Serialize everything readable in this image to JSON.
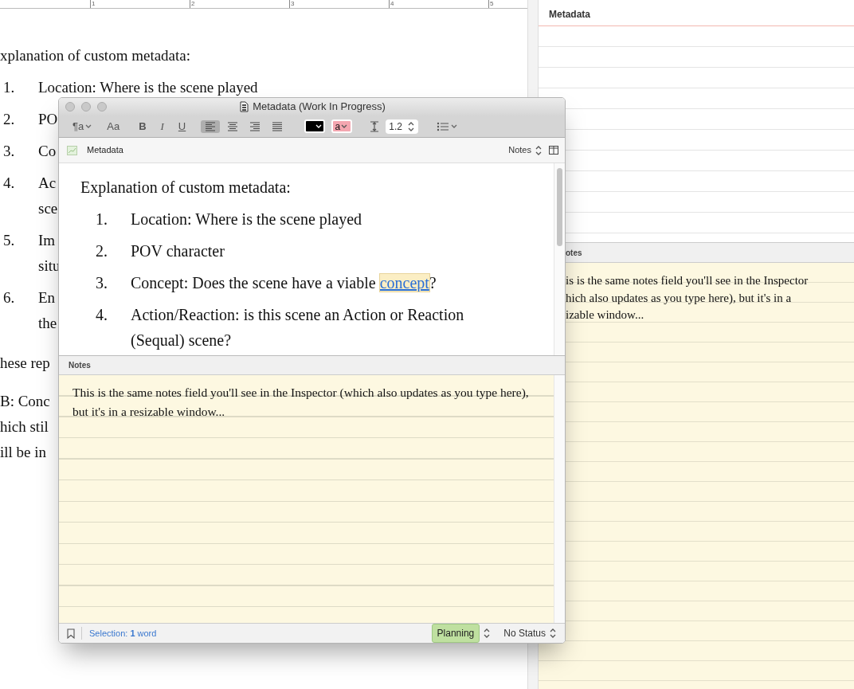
{
  "ruler": {
    "marks": [
      "1",
      "2",
      "3",
      "4",
      "5"
    ]
  },
  "editor": {
    "heading": "xplanation of custom metadata:",
    "list": [
      {
        "number": "1.",
        "lines": [
          "Location: Where is the scene played"
        ]
      },
      {
        "number": "2.",
        "lines": [
          "PO"
        ]
      },
      {
        "number": "3.",
        "lines": [
          "Co"
        ]
      },
      {
        "number": "4.",
        "lines": [
          "Ac",
          "sce"
        ]
      },
      {
        "number": "5.",
        "lines": [
          "Im",
          "situ"
        ]
      },
      {
        "number": "6.",
        "lines": [
          "En",
          "the"
        ]
      }
    ],
    "paragraphs": [
      [
        "hese rep"
      ],
      [
        "B: Conc",
        "hich stil",
        "ill be in"
      ]
    ]
  },
  "inspector": {
    "metadata_header": "Metadata",
    "notes_header": "otes",
    "notes_lines": [
      "is is the same notes field you'll see in the Inspector",
      "hich also updates as you type here), but it's in a",
      "izable window..."
    ]
  },
  "window": {
    "title": "Metadata (Work In Progress)",
    "toolbar": {
      "paragraph_style": "¶a",
      "fonts": "Aa",
      "bold": "B",
      "italic": "I",
      "underline": "U",
      "alignments": [
        {
          "kind": "left",
          "selected": true
        },
        {
          "kind": "center",
          "selected": false
        },
        {
          "kind": "right",
          "selected": false
        },
        {
          "kind": "justify",
          "selected": false
        }
      ],
      "highlight": "a",
      "line_spacing": "1.2"
    },
    "header": {
      "title": "Metadata",
      "view": "Notes"
    },
    "content": {
      "heading": "Explanation of custom metadata:",
      "list": [
        {
          "number": "1.",
          "text": "Location: Where is the scene played"
        },
        {
          "number": "2.",
          "text": "POV character"
        },
        {
          "number": "3.",
          "text": "Concept: Does the scene have a viable ",
          "link": "concept",
          "after": "?"
        },
        {
          "number": "4.",
          "text": "Action/Reaction: is this scene an Action or Reaction (Sequal) scene?"
        }
      ]
    },
    "notes": {
      "header": "Notes",
      "text": "This is the same notes field you'll see in the Inspector (which also updates as you type here), but it's in a resizable window..."
    },
    "status_bar": {
      "selection": "Selection: **1** word",
      "label": {
        "text": "Planning",
        "color": "#bfe0a0"
      },
      "status": "No Status"
    }
  }
}
